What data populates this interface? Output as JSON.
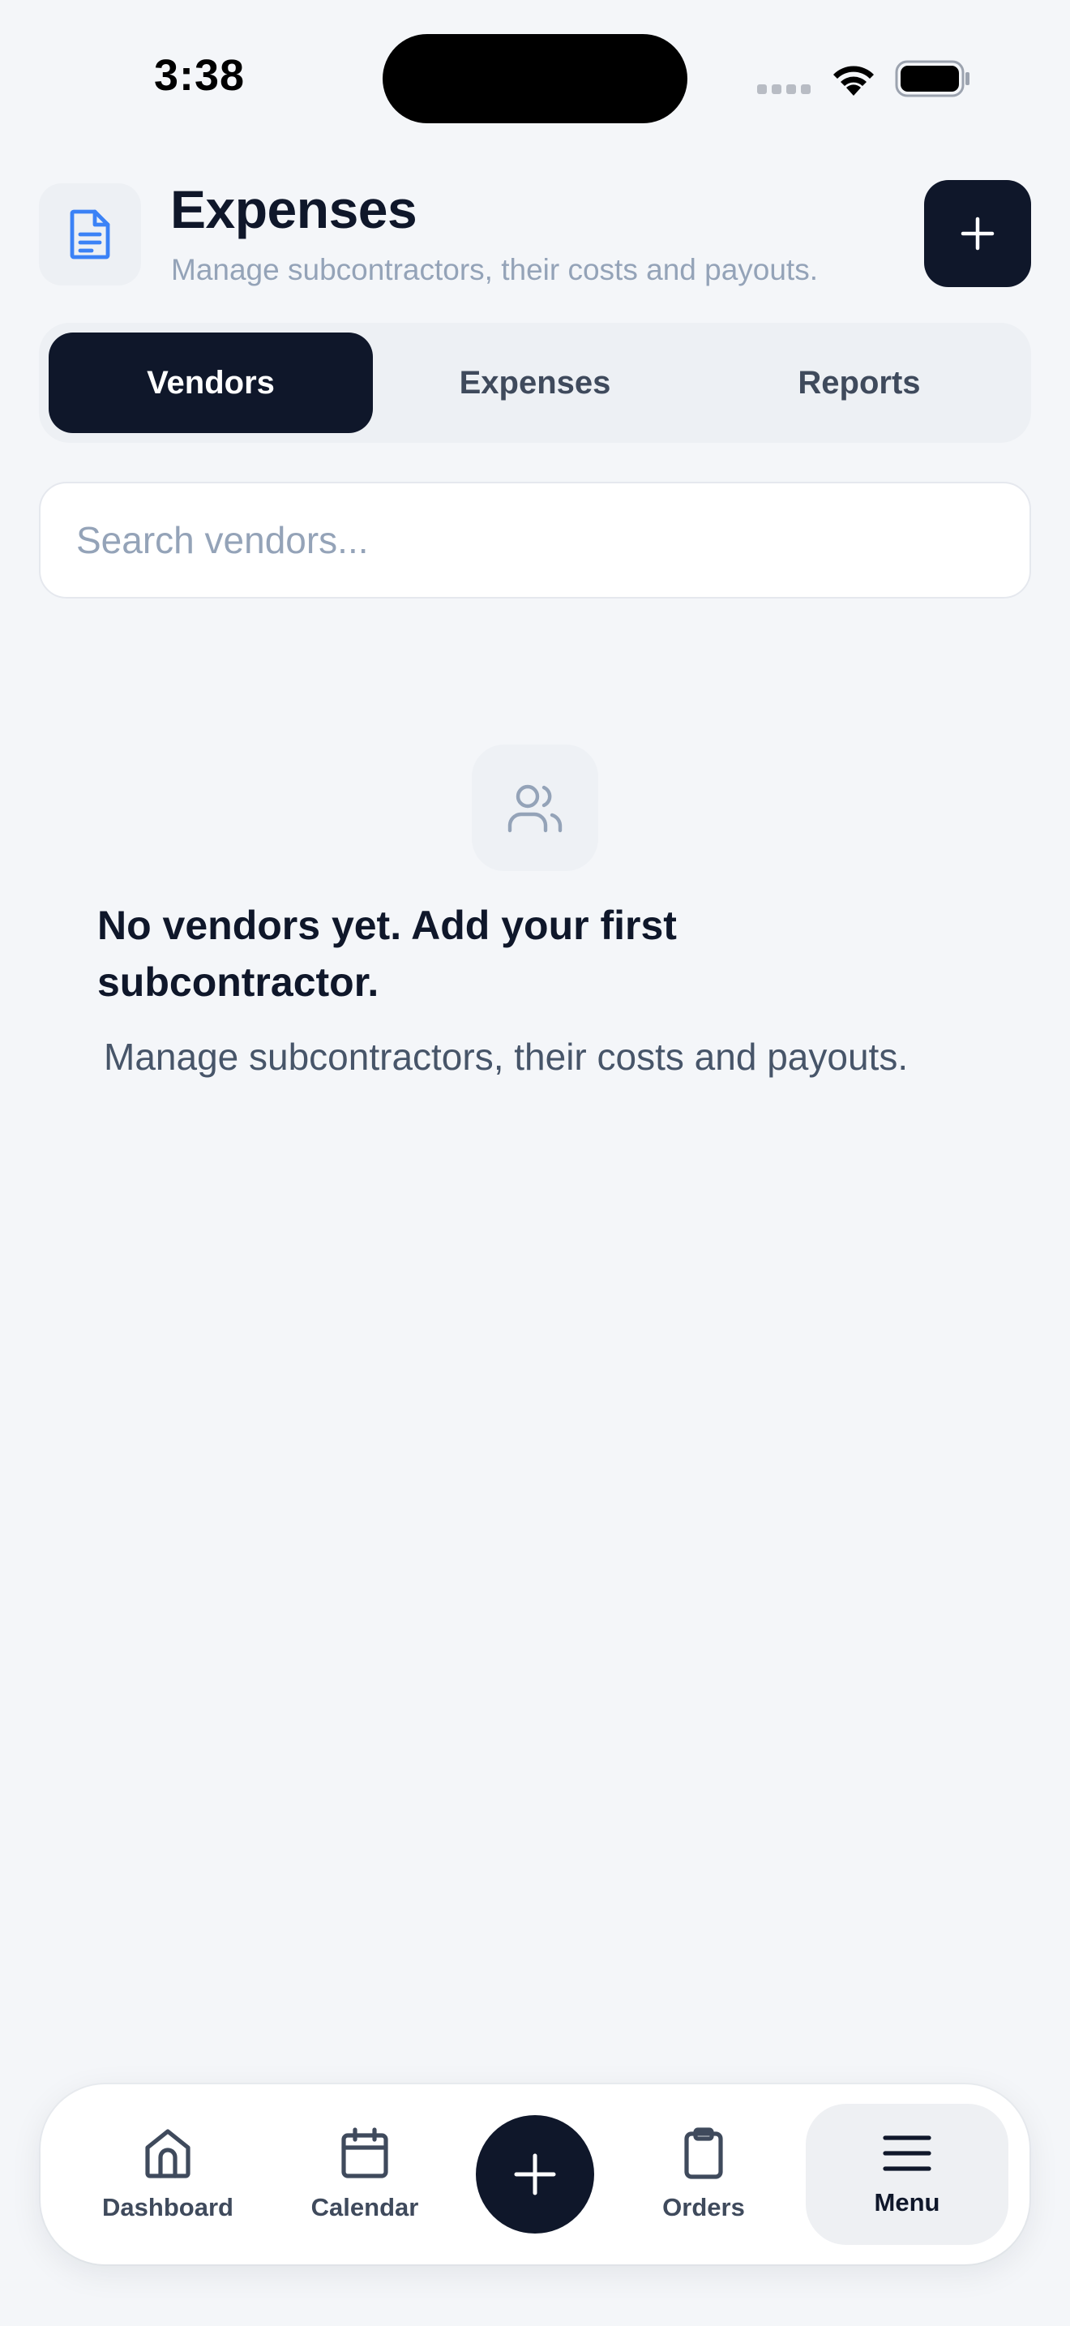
{
  "status_bar": {
    "time": "3:38"
  },
  "header": {
    "title": "Expenses",
    "subtitle": "Manage subcontractors, their costs and payouts."
  },
  "tabs": [
    {
      "label": "Vendors",
      "active": true
    },
    {
      "label": "Expenses",
      "active": false
    },
    {
      "label": "Reports",
      "active": false
    }
  ],
  "search": {
    "placeholder": "Search vendors...",
    "value": ""
  },
  "empty_state": {
    "title": "No vendors yet. Add your first subcontractor.",
    "subtitle": "Manage subcontractors, their costs and payouts."
  },
  "bottom_nav": {
    "items": [
      {
        "label": "Dashboard",
        "icon": "home-icon"
      },
      {
        "label": "Calendar",
        "icon": "calendar-icon"
      },
      {
        "label": "Orders",
        "icon": "clipboard-icon"
      },
      {
        "label": "Menu",
        "icon": "menu-icon",
        "active": true
      }
    ]
  },
  "colors": {
    "background": "#f4f6f9",
    "primary_dark": "#0f172a",
    "accent_blue": "#3b82f6",
    "muted_text": "#94a3b8"
  }
}
